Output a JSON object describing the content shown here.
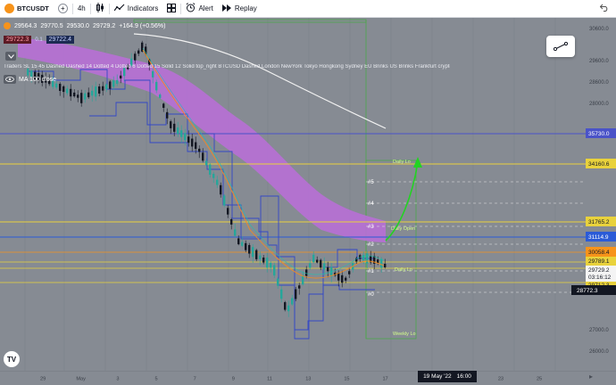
{
  "toolbar": {
    "symbol": "BTCUSDT",
    "interval": "4h",
    "indicators_label": "Indicators",
    "alert_label": "Alert",
    "replay_label": "Replay"
  },
  "legend": {
    "ohlc_open": "29564.3",
    "ohlc_high": "29770.5",
    "ohlc_low": "29530.0",
    "ohlc_close": "29729.2",
    "change": "+164.9 (+0.56%)",
    "bid_price": "29722.3",
    "spread": "0.1",
    "ask_price": "29722.4",
    "indicator_text": "Traders SL 15 45 Dashed Dashed 14 Dotted 4 Dotted 6 Dotted 15 Solid 12 Solid top_right BTCUSD Dashed London NewYork Tokyo Hongkong Sydney EU Brinks US Brinks Frankfurt crypto b...",
    "ma_label": "MA 100 close"
  },
  "colors": {
    "background": "#868b93",
    "candle_up": "#26a69a",
    "candle_down": "#131722",
    "ema_band": "#b86fd6",
    "resistance": "#e9d23c",
    "support_blue": "#4a53c8",
    "projection": "#22d422"
  },
  "chart_data": {
    "type": "candlestick",
    "y_range": [
      25800,
      30900
    ],
    "y_ticks": [
      "30600.0",
      "29600.0",
      "28600.0",
      "28000.0",
      "27000.0",
      "26000.0"
    ],
    "x_ticks": [
      "29",
      "May",
      "3",
      "5",
      "7",
      "9",
      "11",
      "13",
      "15",
      "17",
      "19",
      "21",
      "23",
      "25"
    ],
    "price_levels": [
      {
        "label": "35730.0",
        "color": "#4a53c8"
      },
      {
        "label": "34160.6",
        "color": "#e9d23c"
      },
      {
        "label": "31765.2",
        "color": "#e9d23c"
      },
      {
        "label": "31114.9",
        "color": "#2b5bd7"
      },
      {
        "label": "30058.4",
        "color": "#f7931a"
      },
      {
        "label": "29789.1",
        "color": "#e9d23c"
      },
      {
        "label": "29729.2",
        "color": "#ffffff"
      },
      {
        "label": "03:16:12",
        "color": "#ffffff"
      },
      {
        "label": "29712.3",
        "color": "#e9d23c"
      },
      {
        "label": "28772.3",
        "color": "#131722"
      }
    ],
    "fib_labels": [
      "#5",
      "#4",
      "#3",
      "#2",
      "#1",
      "#0"
    ],
    "annotations": [
      "Daily Lo",
      "Daily Open",
      "Daily Lo",
      "Weekly Lo"
    ],
    "crosshair_date": "19 May '22",
    "crosshair_time": "16:00"
  }
}
